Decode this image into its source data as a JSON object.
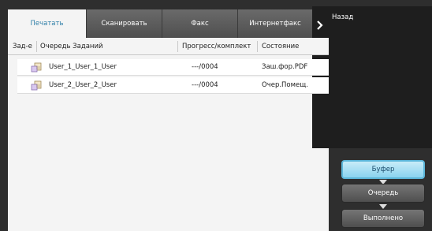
{
  "tabs": [
    {
      "label": "Печатать",
      "active": true
    },
    {
      "label": "Сканировать",
      "active": false
    },
    {
      "label": "Факс",
      "active": false
    },
    {
      "label": "Интернетфакс",
      "active": false
    }
  ],
  "back": {
    "label": "Назад",
    "icon": "chevron-right-icon"
  },
  "table": {
    "headers": [
      "Зад-е",
      "Очередь Заданий",
      "Прогресс/комплект",
      "Состояние"
    ],
    "rows": [
      {
        "job": "User_1_User_1_User",
        "progress": "---/0004",
        "status": "Заш.фор.PDF",
        "icon": "print-job-icon"
      },
      {
        "job": "User_2_User_2_User",
        "progress": "---/0004",
        "status": "Очер.Помещ.",
        "icon": "print-job-icon"
      }
    ]
  },
  "buttons": {
    "buffer": "Буфер",
    "queue": "Очередь",
    "done": "Выполнено"
  },
  "colors": {
    "accent_tab_text": "#2f7fa8",
    "selected_button": "#8ad3ef",
    "dark_panel": "#2e2e2e"
  }
}
